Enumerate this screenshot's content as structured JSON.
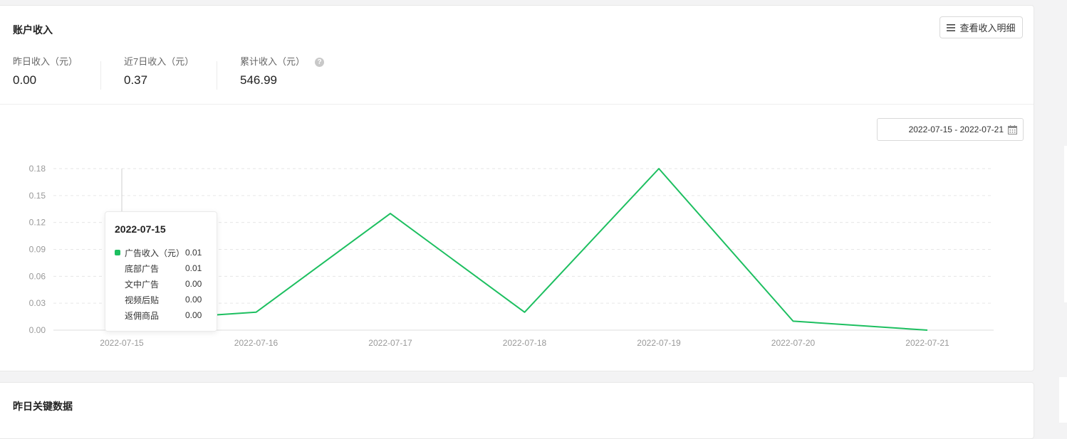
{
  "income_card": {
    "title": "账户收入",
    "detail_button": "查看收入明细",
    "stats": [
      {
        "label": "昨日收入（元）",
        "value": "0.00"
      },
      {
        "label": "近7日收入（元）",
        "value": "0.37"
      },
      {
        "label": "累计收入（元）",
        "value": "546.99"
      }
    ],
    "date_range": "2022-07-15 - 2022-07-21"
  },
  "chart_data": {
    "type": "line",
    "categories": [
      "2022-07-15",
      "2022-07-16",
      "2022-07-17",
      "2022-07-18",
      "2022-07-19",
      "2022-07-20",
      "2022-07-21"
    ],
    "series": [
      {
        "name": "广告收入（元）",
        "values": [
          0.01,
          0.02,
          0.13,
          0.02,
          0.18,
          0.01,
          0.0
        ]
      }
    ],
    "y_ticks": [
      "0.00",
      "0.03",
      "0.06",
      "0.09",
      "0.12",
      "0.15",
      "0.18"
    ],
    "ylim": [
      0,
      0.18
    ],
    "grid": true,
    "line_color": "#1dbf60"
  },
  "tooltip": {
    "date": "2022-07-15",
    "rows": [
      {
        "name": "广告收入（元）",
        "value": "0.01",
        "main": true
      },
      {
        "name": "底部广告",
        "value": "0.01"
      },
      {
        "name": "文中广告",
        "value": "0.00"
      },
      {
        "name": "视频后贴",
        "value": "0.00"
      },
      {
        "name": "返佣商品",
        "value": "0.00"
      }
    ]
  },
  "key_card": {
    "title": "昨日关键数据"
  },
  "colors": {
    "accent": "#1dbf60",
    "background": "#f3f3f4"
  },
  "icons": [
    "menu-icon",
    "help-icon",
    "calendar-icon"
  ]
}
